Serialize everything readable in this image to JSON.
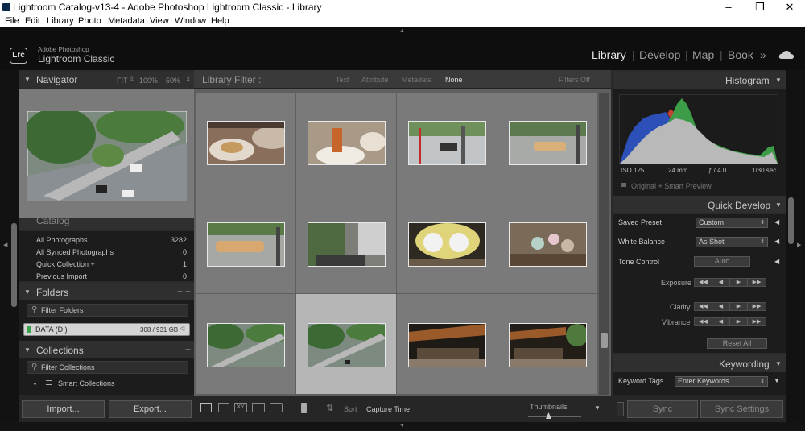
{
  "window": {
    "title": "Lightroom Catalog-v13-4 - Adobe Photoshop Lightroom Classic - Library"
  },
  "menu": [
    "File",
    "Edit",
    "Library",
    "Photo",
    "Metadata",
    "View",
    "Window",
    "Help"
  ],
  "brand": {
    "icon_text": "Lrc",
    "line1": "Adobe Photoshop",
    "line2": "Lightroom Classic"
  },
  "modules": {
    "library": "Library",
    "develop": "Develop",
    "map": "Map",
    "book": "Book",
    "more": "»",
    "cloud_icon": "cloud-icon",
    "sep": "|"
  },
  "navigator": {
    "title": "Navigator",
    "fit": "FIT",
    "z100": "100%",
    "z50": "50%"
  },
  "catalog": {
    "title": "Catalog",
    "items": [
      {
        "label": "All Photographs",
        "count": "3282"
      },
      {
        "label": "All Synced Photographs",
        "count": "0"
      },
      {
        "label": "Quick Collection +",
        "count": "1"
      },
      {
        "label": "Previous Import",
        "count": "0"
      }
    ]
  },
  "folders": {
    "title": "Folders",
    "minus": "−",
    "plus": "+",
    "filter": "Filter Folders",
    "drive": "DATA (D:)",
    "drive_size": "308 / 931 GB"
  },
  "collections": {
    "title": "Collections",
    "plus": "+",
    "filter": "Filter Collections",
    "smart": "Smart Collections"
  },
  "left_buttons": {
    "import": "Import...",
    "export": "Export..."
  },
  "filterbar": {
    "title": "Library Filter :",
    "text": "Text",
    "attribute": "Attribute",
    "metadata": "Metadata",
    "none": "None",
    "filters_off": "Filters Off"
  },
  "toolbar": {
    "sort_label": "Sort",
    "sort_value": "Capture Time",
    "thumbnails": "Thumbnails"
  },
  "histogram": {
    "title": "Histogram",
    "iso": "ISO 125",
    "focal": "24 mm",
    "aperture": "ƒ / 4.0",
    "shutter": "1/30 sec",
    "preview": "Original + Smart Preview"
  },
  "quick_develop": {
    "title": "Quick Develop",
    "saved_preset": "Saved Preset",
    "saved_preset_value": "Custom",
    "white_balance": "White Balance",
    "white_balance_value": "As Shot",
    "tone_control": "Tone Control",
    "auto": "Auto",
    "exposure": "Exposure",
    "clarity": "Clarity",
    "vibrance": "Vibrance",
    "reset": "Reset All"
  },
  "keywording": {
    "title": "Keywording",
    "label": "Keyword Tags",
    "value": "Enter Keywords"
  },
  "right_buttons": {
    "sync": "Sync",
    "sync_settings": "Sync Settings"
  },
  "accent": {
    "selected_cell": "#b6b6b6",
    "cell": "#7a7a7a"
  }
}
